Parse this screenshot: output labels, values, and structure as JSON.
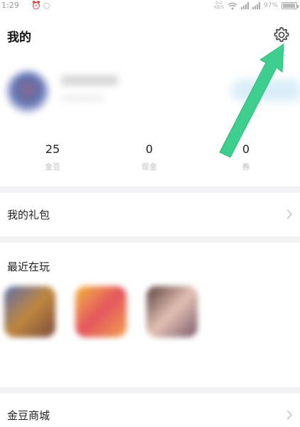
{
  "status_bar": {
    "time": "1:29",
    "left_icons": [
      "alarm-icon",
      "qq-icon"
    ],
    "network_speed_top": "0.0",
    "network_speed_unit": "KB/S",
    "right_icons": [
      "wifi-icon",
      "signal-icon",
      "signal-icon",
      "battery-icon"
    ],
    "battery_text": "97%"
  },
  "header": {
    "title": "我的",
    "settings_icon": "gear-icon"
  },
  "stats": [
    {
      "value": "25",
      "label": "金豆"
    },
    {
      "value": "0",
      "label": "现金"
    },
    {
      "value": "0",
      "label": "券"
    }
  ],
  "menu": {
    "gift_label": "我的礼包",
    "recent_label": "最近在玩",
    "shop_label": "金豆商城"
  },
  "recent_games_count": 3,
  "colors": {
    "annotation_arrow": "#3ecf8e",
    "divider": "#f2f2f4",
    "text_primary": "#222222",
    "text_muted": "#bbbbbb"
  }
}
